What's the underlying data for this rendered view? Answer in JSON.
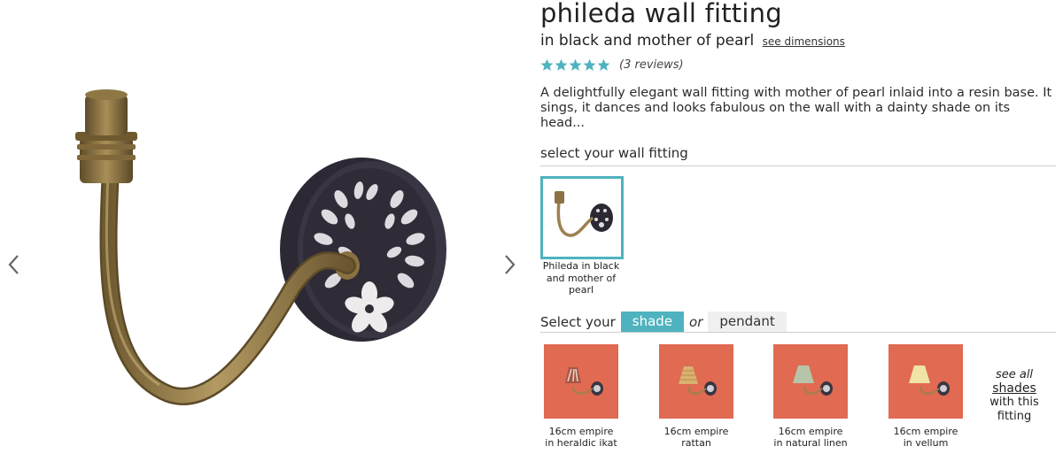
{
  "product": {
    "title": "phileda wall fitting",
    "subtitle": "in black and mother of pearl",
    "dimensions_link": "see dimensions",
    "rating_stars": 5,
    "reviews": "(3 reviews)",
    "description": "A delightfully elegant wall fitting with mother of pearl inlaid into a resin base. It sings, it dances and looks fabulous on the wall with a dainty shade on its head..."
  },
  "fitting_section": {
    "title": "select your wall fitting",
    "options": [
      {
        "label": "Phileda in black and mother of pearl",
        "selected": true
      }
    ]
  },
  "shade_section": {
    "prefix": "Select your",
    "tab_shade": "shade",
    "or": "or",
    "tab_pendant": "pendant",
    "active_tab": "shade",
    "shades": [
      {
        "label_line1": "16cm empire",
        "label_line2": "in heraldic ikat"
      },
      {
        "label_line1": "16cm empire",
        "label_line2": "rattan"
      },
      {
        "label_line1": "16cm empire",
        "label_line2": "in natural linen"
      },
      {
        "label_line1": "16cm empire",
        "label_line2": "in vellum"
      }
    ],
    "see_all_top": "see all",
    "see_all_link": "shades",
    "see_all_bottom": "with this fitting"
  },
  "colors": {
    "accent": "#4fb3bf",
    "star": "#4fb3bf",
    "shade_bg": "#e06a52",
    "plate": "#2c2834",
    "brass": "#a0834c"
  }
}
